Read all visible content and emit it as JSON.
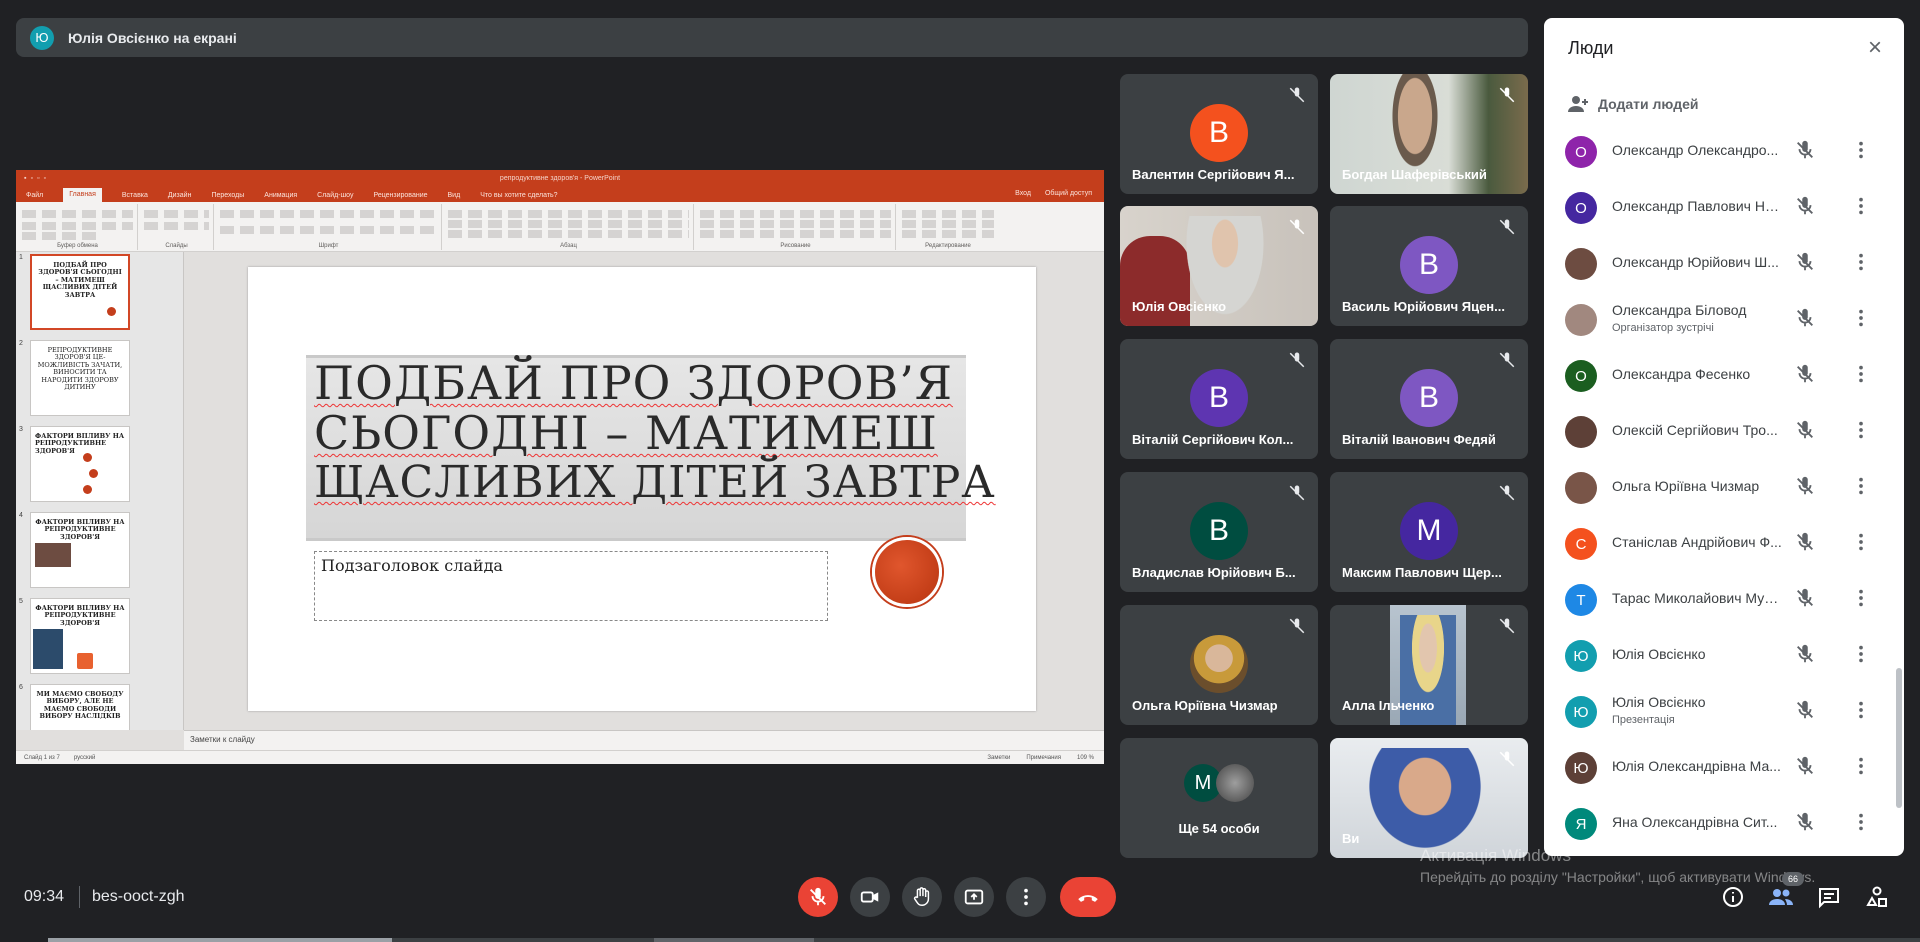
{
  "banner": {
    "initial": "Ю",
    "text": "Юлія Овсієнко на екрані"
  },
  "presentation": {
    "title_bar": "репродуктивне здоров'я - PowerPoint",
    "menu": [
      "Файл",
      "Главная",
      "Вставка",
      "Дизайн",
      "Переходы",
      "Анимация",
      "Слайд-шоу",
      "Рецензирование",
      "Вид",
      "Что вы хотите сделать?"
    ],
    "menu_right": [
      "Вход",
      "Общий доступ"
    ],
    "ribbon_groups": [
      "Буфер обмена",
      "Слайды",
      "Шрифт",
      "Абзац",
      "Рисование",
      "Редактирование"
    ],
    "thumbs": [
      {
        "num": "1",
        "text": "ПОДБАЙ ПРО ЗДОРОВ'Я СЬОГОДНІ – МАТИМЕШ ЩАСЛИВИХ ДІТЕЙ ЗАВТРА"
      },
      {
        "num": "2",
        "text": "РЕПРОДУКТИВНЕ ЗДОРОВ'Я ЦЕ- МОЖЛИВІСТЬ ЗАЧАТИ, ВИНОСИТИ ТА НАРОДИТИ ЗДОРОВУ ДИТИНУ"
      },
      {
        "num": "3",
        "text": "ФАКТОРИ ВПЛИВУ НА РЕПРОДУКТИВНЕ ЗДОРОВ'Я"
      },
      {
        "num": "4",
        "text": "ФАКТОРИ ВПЛИВУ НА РЕПРОДУКТИВНЕ ЗДОРОВ'Я"
      },
      {
        "num": "5",
        "text": "ФАКТОРИ ВПЛИВУ НА РЕПРОДУКТИВНЕ ЗДОРОВ'Я"
      },
      {
        "num": "6",
        "text": "МИ МАЄМО СВОБОДУ ВИБОРУ, АЛЕ НЕ МАЄМО СВОБОДИ ВИБОРУ НАСЛІДКІВ"
      }
    ],
    "slide_title": [
      "ПОДБАЙ ПРО ЗДОРОВ’Я",
      "СЬОГОДНІ – МАТИМЕШ",
      "ЩАСЛИВИХ ДІТЕЙ ЗАВТРА"
    ],
    "slide_subtitle": "Подзаголовок слайда",
    "notes": "Заметки к слайду",
    "status_left": [
      "Слайд 1 из 7",
      "русский"
    ],
    "status_right": [
      "Заметки",
      "Примечания",
      "109 %"
    ]
  },
  "tiles": [
    {
      "name": "Валентин Сергійович Я...",
      "initial": "В",
      "color": "#f4511e",
      "type": "avatar"
    },
    {
      "name": "Богдан Шаферівський",
      "type": "photo"
    },
    {
      "name": "Юлія Овсієнко",
      "type": "photo"
    },
    {
      "name": "Василь Юрійович Яцен...",
      "initial": "В",
      "color": "#7e57c2",
      "type": "avatar"
    },
    {
      "name": "Віталій Сергійович Кол...",
      "initial": "В",
      "color": "#5e35b1",
      "type": "avatar"
    },
    {
      "name": "Віталій Іванович Федяй",
      "initial": "В",
      "color": "#7e57c2",
      "type": "avatar"
    },
    {
      "name": "Владислав Юрійович Б...",
      "initial": "В",
      "color": "#004d40",
      "type": "avatar"
    },
    {
      "name": "Максим Павлович Щер...",
      "initial": "М",
      "color": "#4527a0",
      "type": "avatar"
    },
    {
      "name": "Ольга Юріївна Чизмар",
      "type": "photo"
    },
    {
      "name": "Алла Ільченко",
      "type": "photo"
    },
    {
      "name": "Ще 54 особи",
      "initial": "М",
      "color": "#004d40",
      "type": "more"
    },
    {
      "name": "Ви",
      "type": "photo"
    }
  ],
  "people_panel": {
    "title": "Люди",
    "add_label": "Додати людей",
    "people": [
      {
        "initial": "О",
        "color": "#8e24aa",
        "name": "Олександр Олександро...",
        "sub": "",
        "mic": "off"
      },
      {
        "initial": "О",
        "color": "#4527a0",
        "name": "Олександр Павлович Но...",
        "sub": "",
        "mic": "off"
      },
      {
        "initial": "",
        "color": "#6d4c41",
        "name": "Олександр Юрійович Ш...",
        "sub": "",
        "mic": "off"
      },
      {
        "initial": "",
        "color": "#a1887f",
        "name": "Олександра Біловод",
        "sub": "Організатор зустрічі",
        "mic": "off"
      },
      {
        "initial": "О",
        "color": "#1b5e20",
        "name": "Олександра Фесенко",
        "sub": "",
        "mic": "off"
      },
      {
        "initial": "",
        "color": "#5d4037",
        "name": "Олексій Сергійович Тро...",
        "sub": "",
        "mic": "off"
      },
      {
        "initial": "",
        "color": "#795548",
        "name": "Ольга Юріївна Чизмар",
        "sub": "",
        "mic": "off"
      },
      {
        "initial": "С",
        "color": "#f4511e",
        "name": "Станіслав Андрійович Ф...",
        "sub": "",
        "mic": "off"
      },
      {
        "initial": "Т",
        "color": "#1e88e5",
        "name": "Тарас Миколайович Муз...",
        "sub": "",
        "mic": "off"
      },
      {
        "initial": "Ю",
        "color": "#129eaf",
        "name": "Юлія Овсієнко",
        "sub": "",
        "mic": "off"
      },
      {
        "initial": "Ю",
        "color": "#129eaf",
        "name": "Юлія Овсієнко",
        "sub": "Презентація",
        "mic": "off"
      },
      {
        "initial": "Ю",
        "color": "#5d4037",
        "name": "Юлія Олександрівна Ма...",
        "sub": "",
        "mic": "off"
      },
      {
        "initial": "Я",
        "color": "#00897b",
        "name": "Яна Олександрівна Сит...",
        "sub": "",
        "mic": "off"
      }
    ]
  },
  "bottom_bar": {
    "time": "09:34",
    "meeting_code": "bes-ooct-zgh",
    "participants_count": "66"
  },
  "watermark": {
    "line1": "Активація Windows",
    "line2": "Перейдіть до розділу \"Настройки\", щоб активувати Windows."
  }
}
